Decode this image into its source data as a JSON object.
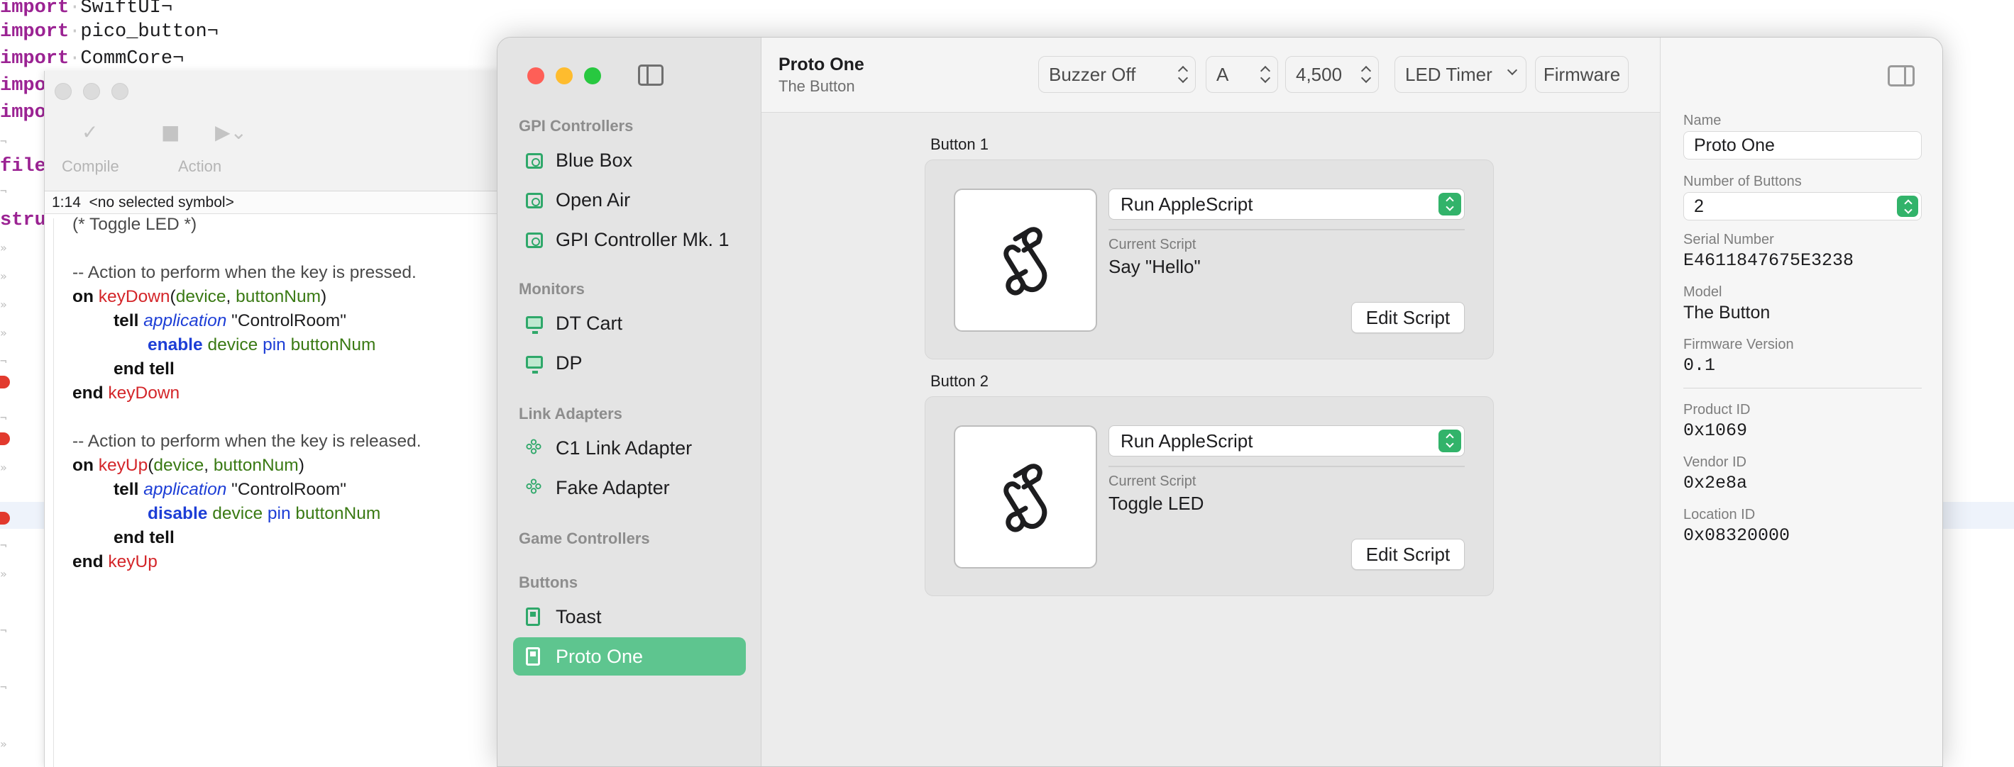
{
  "background_editor": {
    "lines": [
      {
        "keyword": "import",
        "rest": "SwiftUI¬"
      },
      {
        "keyword": "import",
        "rest": "pico_button¬"
      },
      {
        "keyword": "import",
        "rest": "CommCore¬"
      },
      {
        "keyword": "impo",
        "rest": ""
      },
      {
        "keyword": "impo",
        "rest": ""
      },
      {
        "keyword": "filep",
        "rest": ""
      },
      {
        "keyword": "struc",
        "rest": ""
      }
    ]
  },
  "script_editor": {
    "toolbar": {
      "compile_label": "Compile",
      "action_label": "Action"
    },
    "nav": {
      "position": "1:14",
      "symbol": "<no selected symbol>"
    },
    "code": {
      "title_comment": "(* Toggle LED *)",
      "pressed_comment": "-- Action to perform when the key is pressed.",
      "released_comment": "-- Action to perform when the key is released.",
      "on": "on",
      "end": "end",
      "tell": "tell",
      "end_tell": "end tell",
      "application": "application",
      "app_name": "\"ControlRoom\"",
      "key_down": "keyDown",
      "key_up": "keyUp",
      "device": "device",
      "button_num": "buttonNum",
      "open_paren": "(",
      "comma": ", ",
      "close_paren": ")",
      "enable": "enable",
      "disable": "disable",
      "pin": "pin"
    }
  },
  "app": {
    "sidebar": {
      "sections": [
        {
          "title": "GPI Controllers",
          "items": [
            "Blue Box",
            "Open Air",
            "GPI Controller Mk. 1"
          ]
        },
        {
          "title": "Monitors",
          "items": [
            "DT Cart",
            "DP"
          ]
        },
        {
          "title": "Link Adapters",
          "items": [
            "C1 Link Adapter",
            "Fake Adapter"
          ]
        },
        {
          "title": "Game Controllers",
          "items": []
        },
        {
          "title": "Buttons",
          "items": [
            "Toast",
            "Proto One"
          ]
        }
      ],
      "selected_item": "Proto One"
    },
    "header": {
      "title": "Proto One",
      "subtitle": "The Button",
      "buzzer": "Buzzer Off",
      "channel": "A",
      "timer_value": "4,500",
      "led_mode": "LED Timer",
      "firmware_button": "Firmware"
    },
    "buttons": [
      {
        "label": "Button 1",
        "action": "Run AppleScript",
        "current_script_label": "Current Script",
        "current_script": "Say \"Hello\"",
        "edit_label": "Edit Script"
      },
      {
        "label": "Button 2",
        "action": "Run AppleScript",
        "current_script_label": "Current Script",
        "current_script": "Toggle LED",
        "edit_label": "Edit Script"
      }
    ],
    "inspector": {
      "name_label": "Name",
      "name_value": "Proto One",
      "num_buttons_label": "Number of Buttons",
      "num_buttons_value": "2",
      "serial_label": "Serial Number",
      "serial_value": "E4611847675E3238",
      "model_label": "Model",
      "model_value": "The Button",
      "firmware_label": "Firmware Version",
      "firmware_value": "0.1",
      "product_id_label": "Product ID",
      "product_id_value": "0x1069",
      "vendor_id_label": "Vendor ID",
      "vendor_id_value": "0x2e8a",
      "location_id_label": "Location ID",
      "location_id_value": "0x08320000"
    },
    "colors": {
      "accent_green": "#32b36a",
      "selection_green": "#5ec58f",
      "close_red": "#fe5f57",
      "minimize_yellow": "#febc2e",
      "zoom_green": "#28c840"
    },
    "icons": [
      "sidebar-toggle-icon",
      "inspector-toggle-icon",
      "script-scroll-icon",
      "gpi-controller-icon",
      "monitor-icon",
      "link-adapter-icon",
      "button-device-icon"
    ]
  }
}
